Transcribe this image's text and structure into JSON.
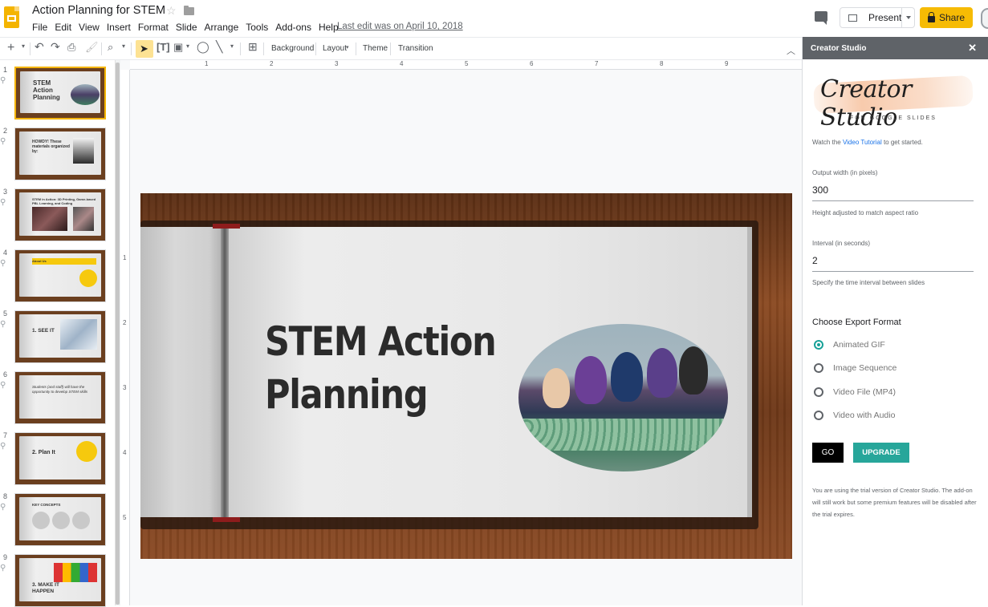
{
  "app": {
    "title": "Action Planning for STEM",
    "menus": [
      "File",
      "Edit",
      "View",
      "Insert",
      "Format",
      "Slide",
      "Arrange",
      "Tools",
      "Add-ons",
      "Help"
    ],
    "last_edit": "Last edit was on April 10, 2018",
    "present_label": "Present",
    "share_label": "Share",
    "accent_color": "#f4b400"
  },
  "toolbar": {
    "background": "Background",
    "layout": "Layout",
    "theme": "Theme",
    "transition": "Transition"
  },
  "ruler": {
    "h_marks": [
      "1",
      "2",
      "3",
      "4",
      "5",
      "6",
      "7",
      "8",
      "9"
    ],
    "v_marks": [
      "1",
      "2",
      "3",
      "4",
      "5"
    ]
  },
  "filmstrip": [
    {
      "num": "1",
      "text": "STEM Action Planning",
      "selected": true
    },
    {
      "num": "2",
      "text": "HOWDY! These materials organized by:",
      "selected": false
    },
    {
      "num": "3",
      "text": "STEM in Action: 3D Printing, Game-based PBL Learning, and Coding",
      "selected": false
    },
    {
      "num": "4",
      "text": "About Us",
      "selected": false
    },
    {
      "num": "5",
      "text": "1. SEE IT",
      "selected": false
    },
    {
      "num": "6",
      "text": "Students (and staff) will have the opportunity to develop STEM skills",
      "selected": false
    },
    {
      "num": "7",
      "text": "2. Plan It",
      "selected": false
    },
    {
      "num": "8",
      "text": "KEY CONCEPTS",
      "selected": false
    },
    {
      "num": "9",
      "text": "3. MAKE IT HAPPEN",
      "selected": false
    }
  ],
  "slide": {
    "title_line1": "STEM Action",
    "title_line2": "Planning"
  },
  "panel": {
    "header": "Creator Studio",
    "brand": "Creator Studio",
    "brand_sub": "FOR GOOGLE SLIDES",
    "intro_pre": "Watch the ",
    "intro_link": "Video Tutorial",
    "intro_post": " to get started.",
    "width_label": "Output width (in pixels)",
    "width_value": "300",
    "width_help": "Height adjusted to match aspect ratio",
    "interval_label": "Interval (in seconds)",
    "interval_value": "2",
    "interval_help": "Specify the time interval between slides",
    "format_heading": "Choose Export Format",
    "formats": [
      "Animated GIF",
      "Image Sequence",
      "Video File (MP4)",
      "Video with Audio"
    ],
    "selected_format": "Animated GIF",
    "go_label": "GO",
    "upgrade_label": "UPGRADE",
    "trial_note": "You are using the trial version of Creator Studio. The add-on will still work but some premium features will be disabled after the trial expires.",
    "accent_color": "#27a69a"
  }
}
